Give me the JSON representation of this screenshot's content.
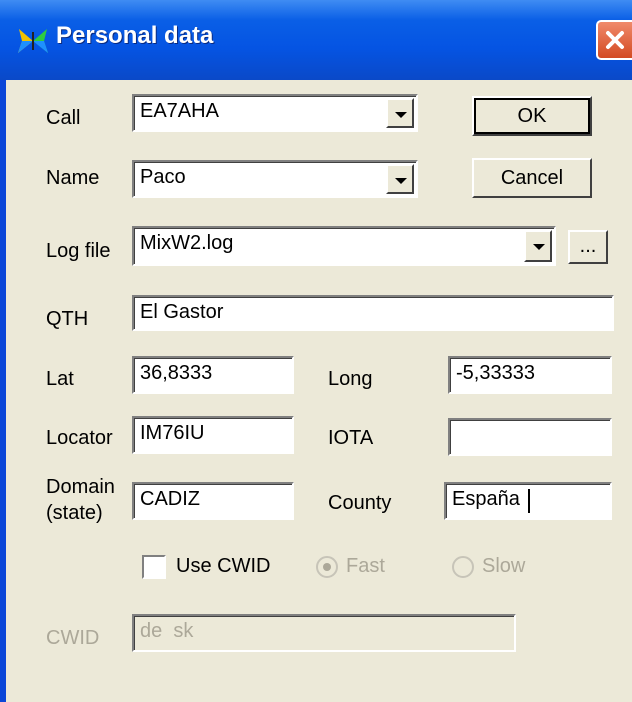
{
  "window": {
    "title": "Personal data"
  },
  "icons": {
    "app": "butterfly-icon",
    "close": "close-icon",
    "dropdown": "chevron-down-icon"
  },
  "fields": {
    "call": {
      "label": "Call",
      "value": "EA7AHA"
    },
    "name": {
      "label": "Name",
      "value": "Paco"
    },
    "log_file": {
      "label": "Log file",
      "value": "MixW2.log"
    },
    "qth": {
      "label": "QTH",
      "value": "El Gastor"
    },
    "lat": {
      "label": "Lat",
      "value": "36,8333"
    },
    "long": {
      "label": "Long",
      "value": "-5,33333"
    },
    "locator": {
      "label": "Locator",
      "value": "IM76IU"
    },
    "iota": {
      "label": "IOTA",
      "value": ""
    },
    "domain": {
      "label_line1": "Domain",
      "label_line2": "(state)",
      "value": "CADIZ"
    },
    "county": {
      "label": "County",
      "value": "España"
    },
    "cwid": {
      "label": "CWID",
      "value": "de  sk"
    }
  },
  "options": {
    "use_cwid": {
      "label": "Use CWID",
      "checked": false
    },
    "fast": {
      "label": "Fast",
      "selected": true,
      "enabled": false
    },
    "slow": {
      "label": "Slow",
      "selected": false,
      "enabled": false
    }
  },
  "buttons": {
    "ok": "OK",
    "cancel": "Cancel",
    "browse": "..."
  }
}
